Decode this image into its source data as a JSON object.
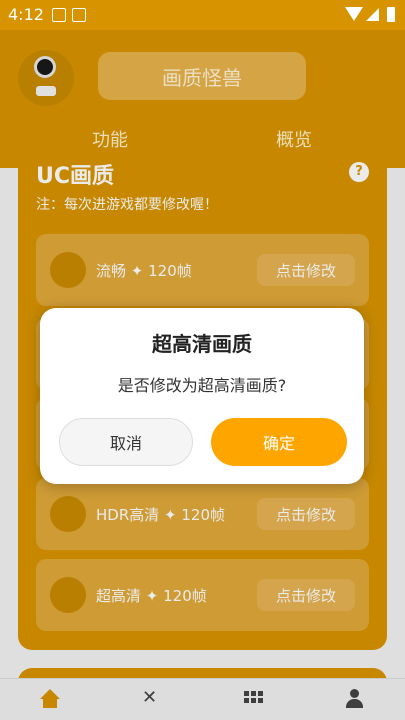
{
  "status_bar": {
    "time": "4:12"
  },
  "header": {
    "title": "画质怪兽",
    "tabs": [
      {
        "label": "功能"
      },
      {
        "label": "概览"
      }
    ]
  },
  "card": {
    "title": "UC画质",
    "help": "?",
    "note": "注：每次进游戏都要修改喔！",
    "options": [
      {
        "label": "流畅 ✦ 120帧",
        "button": "点击修改",
        "icon": "mouse-icon"
      },
      {
        "label": "HDR高清 ✦ 120帧",
        "button": "点击修改",
        "icon": "rabbit-icon"
      },
      {
        "label": "超高清 ✦ 120帧",
        "button": "点击修改",
        "icon": "dragon-icon"
      }
    ]
  },
  "dialog": {
    "title": "超高清画质",
    "message": "是否修改为超高清画质?",
    "cancel_label": "取消",
    "confirm_label": "确定"
  },
  "bottom_nav": {
    "items": [
      {
        "icon": "home-icon"
      },
      {
        "icon": "tools-icon"
      },
      {
        "icon": "grid-icon"
      },
      {
        "icon": "user-icon"
      }
    ]
  },
  "colors": {
    "brand": "#d89400",
    "accent": "#ffa500"
  }
}
